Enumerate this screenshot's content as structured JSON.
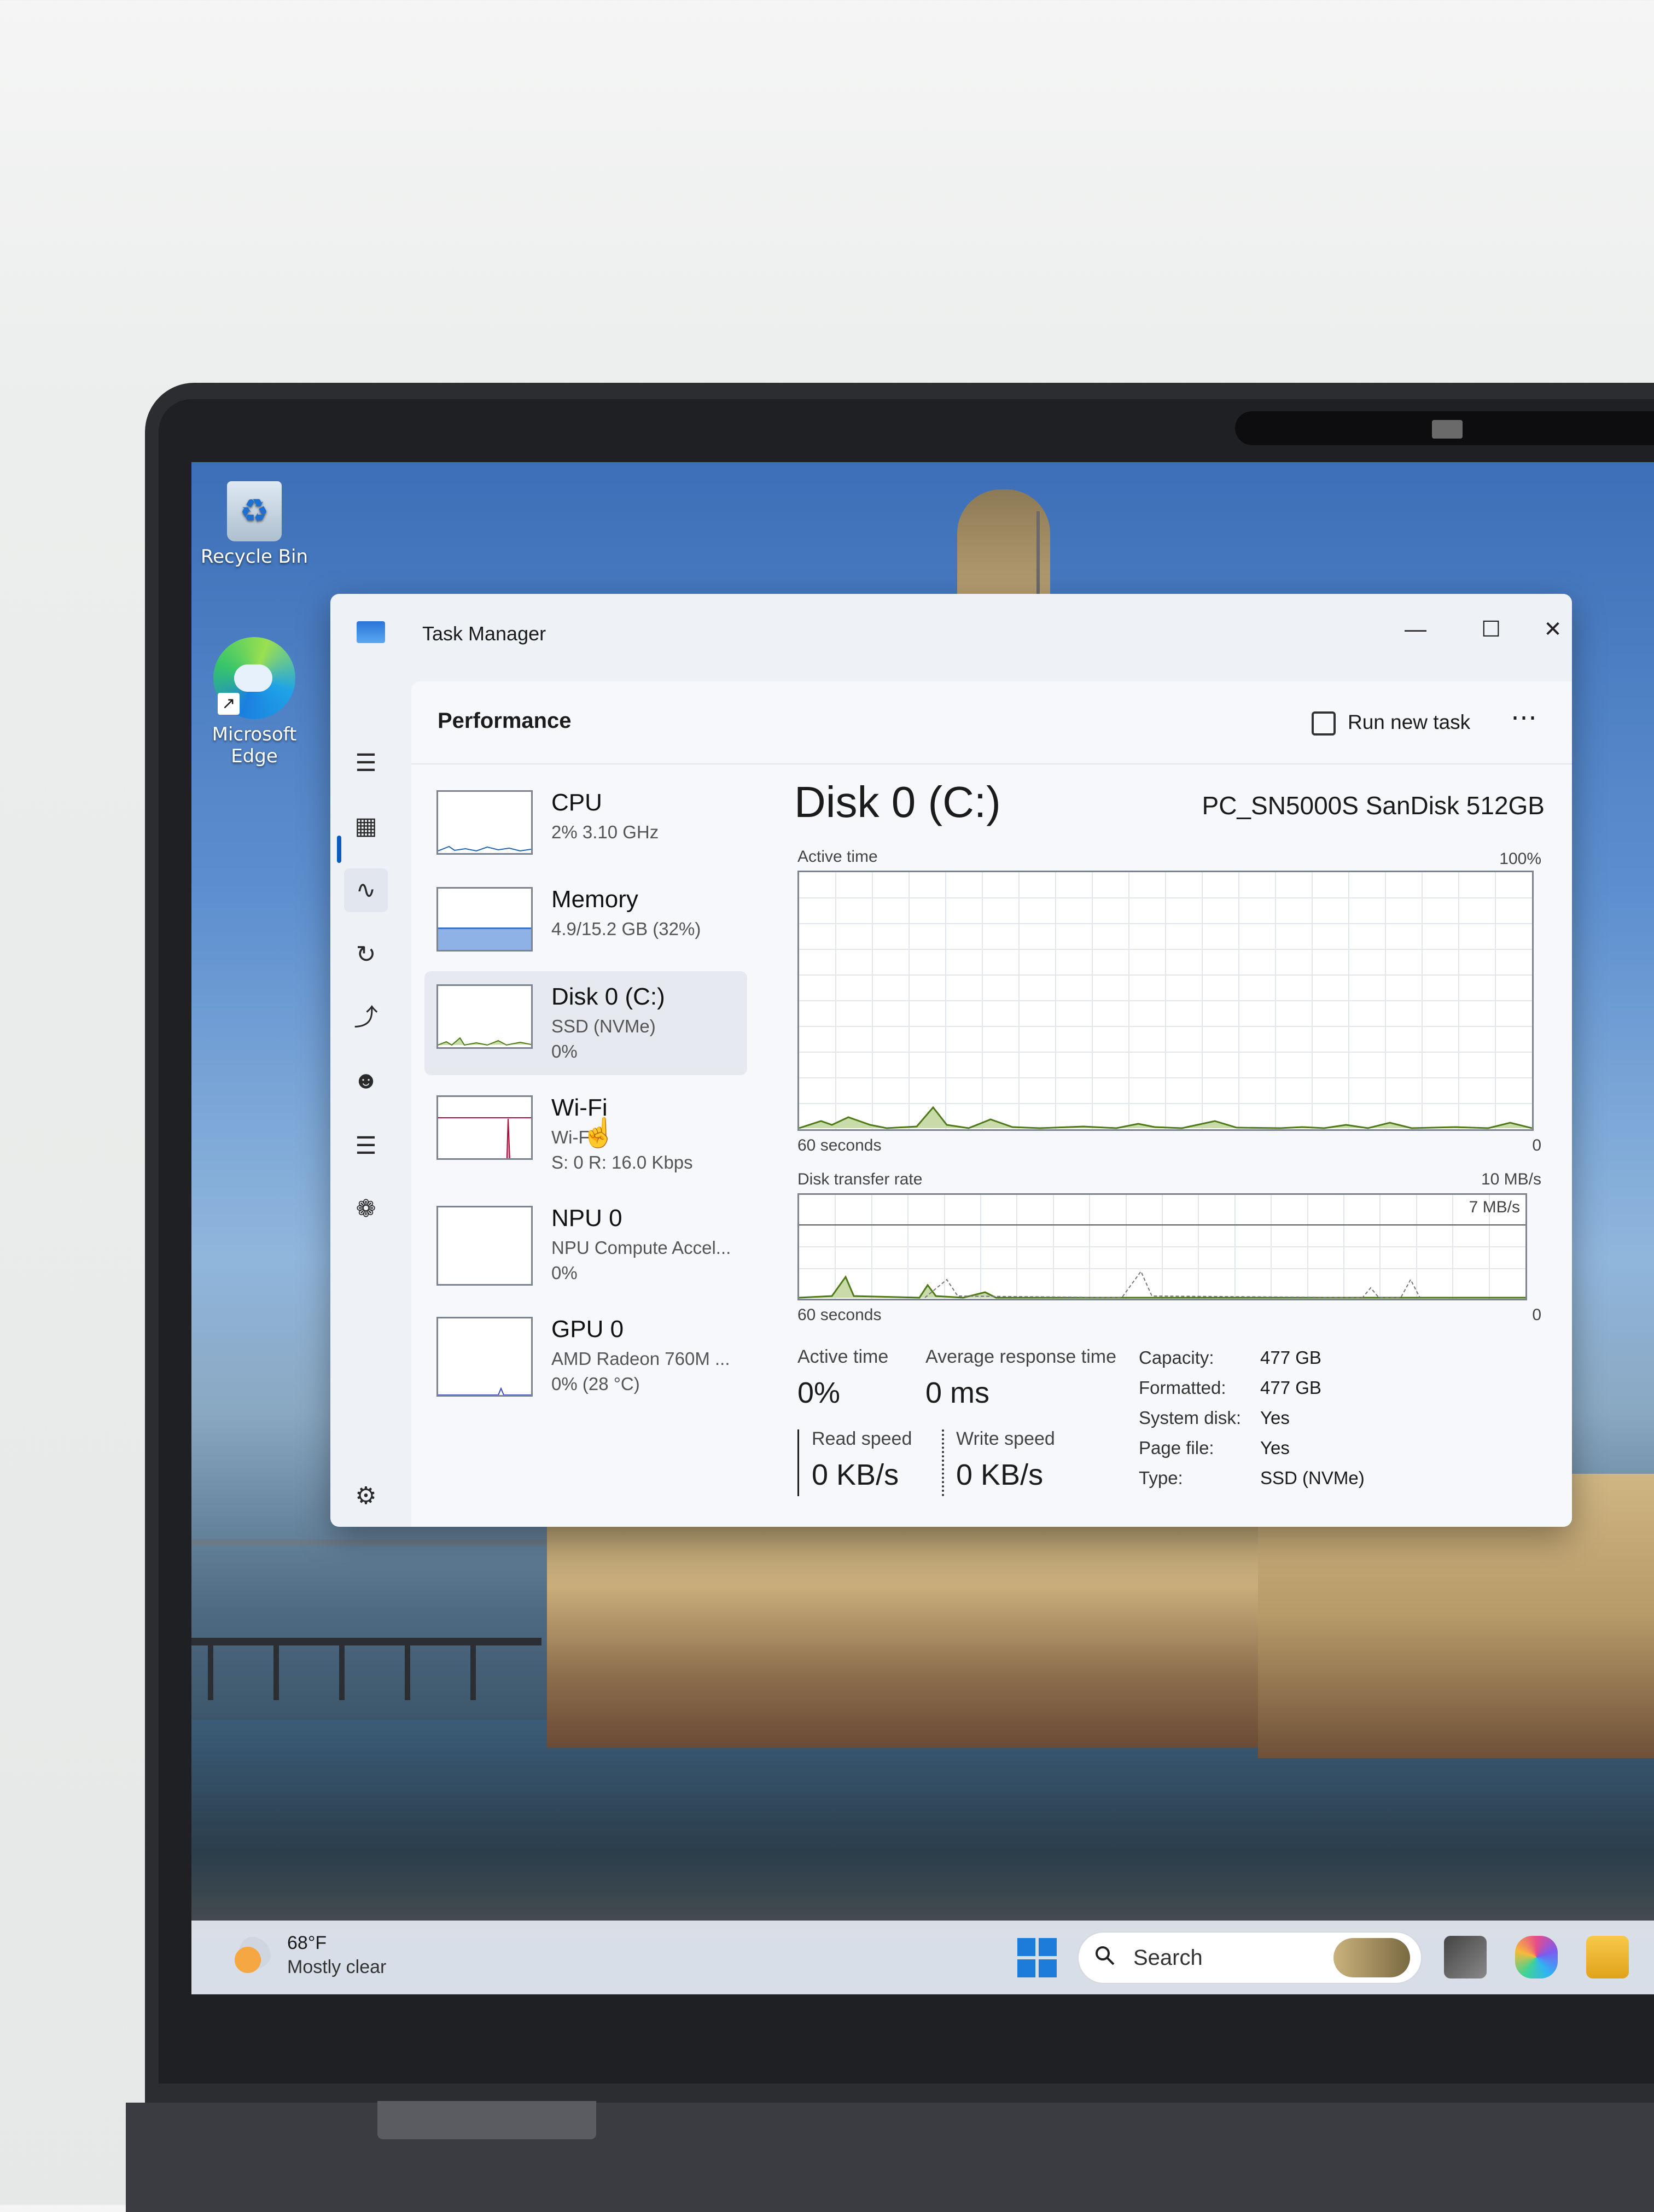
{
  "desktop": {
    "icons": [
      {
        "label": "Recycle Bin"
      },
      {
        "label": "Microsoft Edge"
      }
    ]
  },
  "task_manager": {
    "title": "Task Manager",
    "page_title": "Performance",
    "run_new_task": "Run new task",
    "more_label": "⋯",
    "window_controls": {
      "minimize": "—",
      "maximize": "☐",
      "close": "✕"
    },
    "devices": [
      {
        "name": "CPU",
        "line1": "2% 3.10 GHz",
        "line2": ""
      },
      {
        "name": "Memory",
        "line1": "4.9/15.2 GB (32%)",
        "line2": ""
      },
      {
        "name": "Disk 0 (C:)",
        "line1": "SSD (NVMe)",
        "line2": "0%"
      },
      {
        "name": "Wi-Fi",
        "line1": "Wi-Fi",
        "line2": "S: 0 R: 16.0 Kbps"
      },
      {
        "name": "NPU 0",
        "line1": "NPU Compute Accel...",
        "line2": "0%"
      },
      {
        "name": "GPU 0",
        "line1": "AMD Radeon 760M ...",
        "line2": "0% (28 °C)"
      }
    ],
    "selected_device": "Disk 0 (C:)",
    "detail": {
      "title": "Disk 0 (C:)",
      "model": "PC_SN5000S SanDisk 512GB",
      "graph1": {
        "label": "Active time",
        "max": "100%",
        "time": "60 seconds",
        "min": "0"
      },
      "graph2": {
        "label": "Disk transfer rate",
        "max": "10 MB/s",
        "inner_max": "7 MB/s",
        "time": "60 seconds",
        "min": "0"
      },
      "stats": {
        "active_time_label": "Active time",
        "active_time_value": "0%",
        "avg_response_label": "Average response time",
        "avg_response_value": "0 ms",
        "read_speed_label": "Read speed",
        "read_speed_value": "0 KB/s",
        "write_speed_label": "Write speed",
        "write_speed_value": "0 KB/s"
      },
      "properties": [
        {
          "label": "Capacity:",
          "value": "477 GB"
        },
        {
          "label": "Formatted:",
          "value": "477 GB"
        },
        {
          "label": "System disk:",
          "value": "Yes"
        },
        {
          "label": "Page file:",
          "value": "Yes"
        },
        {
          "label": "Type:",
          "value": "SSD (NVMe)"
        }
      ]
    },
    "colors": {
      "disk_graph": "#4d7a17",
      "disk_fill": "#c9dba8",
      "wifi_graph": "#a80f3a",
      "memory_fill": "#8fb2e6",
      "cpu_graph": "#1f64b8"
    }
  },
  "taskbar": {
    "weather_temp": "68°F",
    "weather_desc": "Mostly clear",
    "search_placeholder": "Search"
  }
}
